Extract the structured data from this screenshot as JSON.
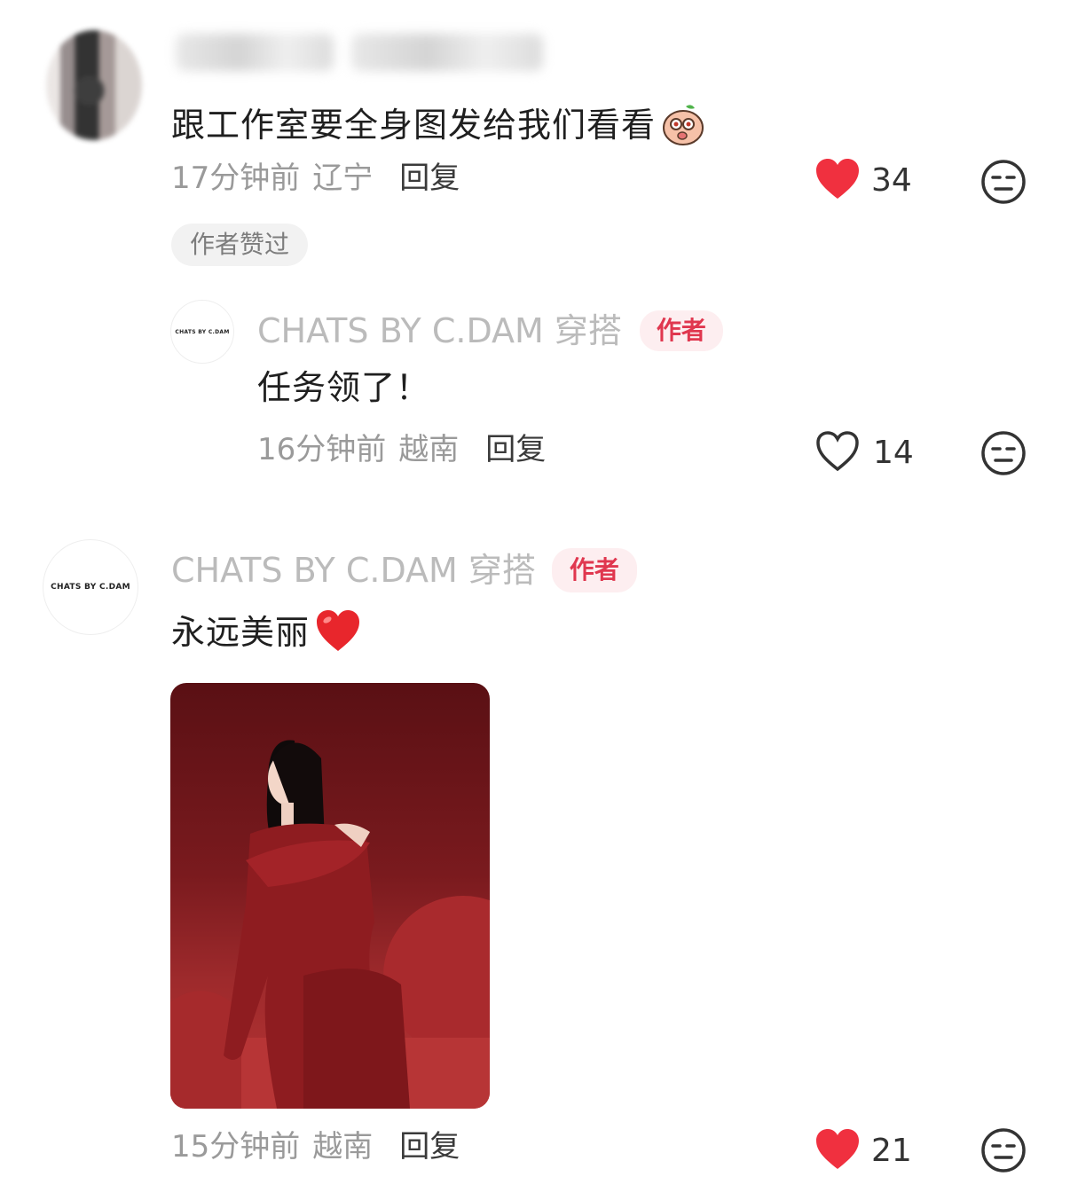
{
  "colors": {
    "accent_red": "#f0303f",
    "author_tag_text": "#e0374f",
    "author_tag_bg": "#fdeef0",
    "meta_gray": "#9a9a9a"
  },
  "comments": [
    {
      "text": "跟工作室要全身图发给我们看看",
      "emoji": "peach-face-emoji",
      "time": "17分钟前",
      "location": "辽宁",
      "reply_label": "回复",
      "likes": "34",
      "liked": true,
      "badge": "作者赞过",
      "replies": [
        {
          "author": "CHATS BY C.DAM 穿搭",
          "avatar_text": "CHATS BY C.DAM",
          "author_tag": "作者",
          "text": "任务领了！",
          "time": "16分钟前",
          "location": "越南",
          "reply_label": "回复",
          "likes": "14",
          "liked": false
        }
      ]
    },
    {
      "author": "CHATS BY C.DAM 穿搭",
      "avatar_text": "CHATS BY C.DAM",
      "author_tag": "作者",
      "text": "永远美丽",
      "emoji": "red-heart-emoji",
      "time": "15分钟前",
      "location": "越南",
      "reply_label": "回复",
      "likes": "21",
      "liked": true
    }
  ]
}
